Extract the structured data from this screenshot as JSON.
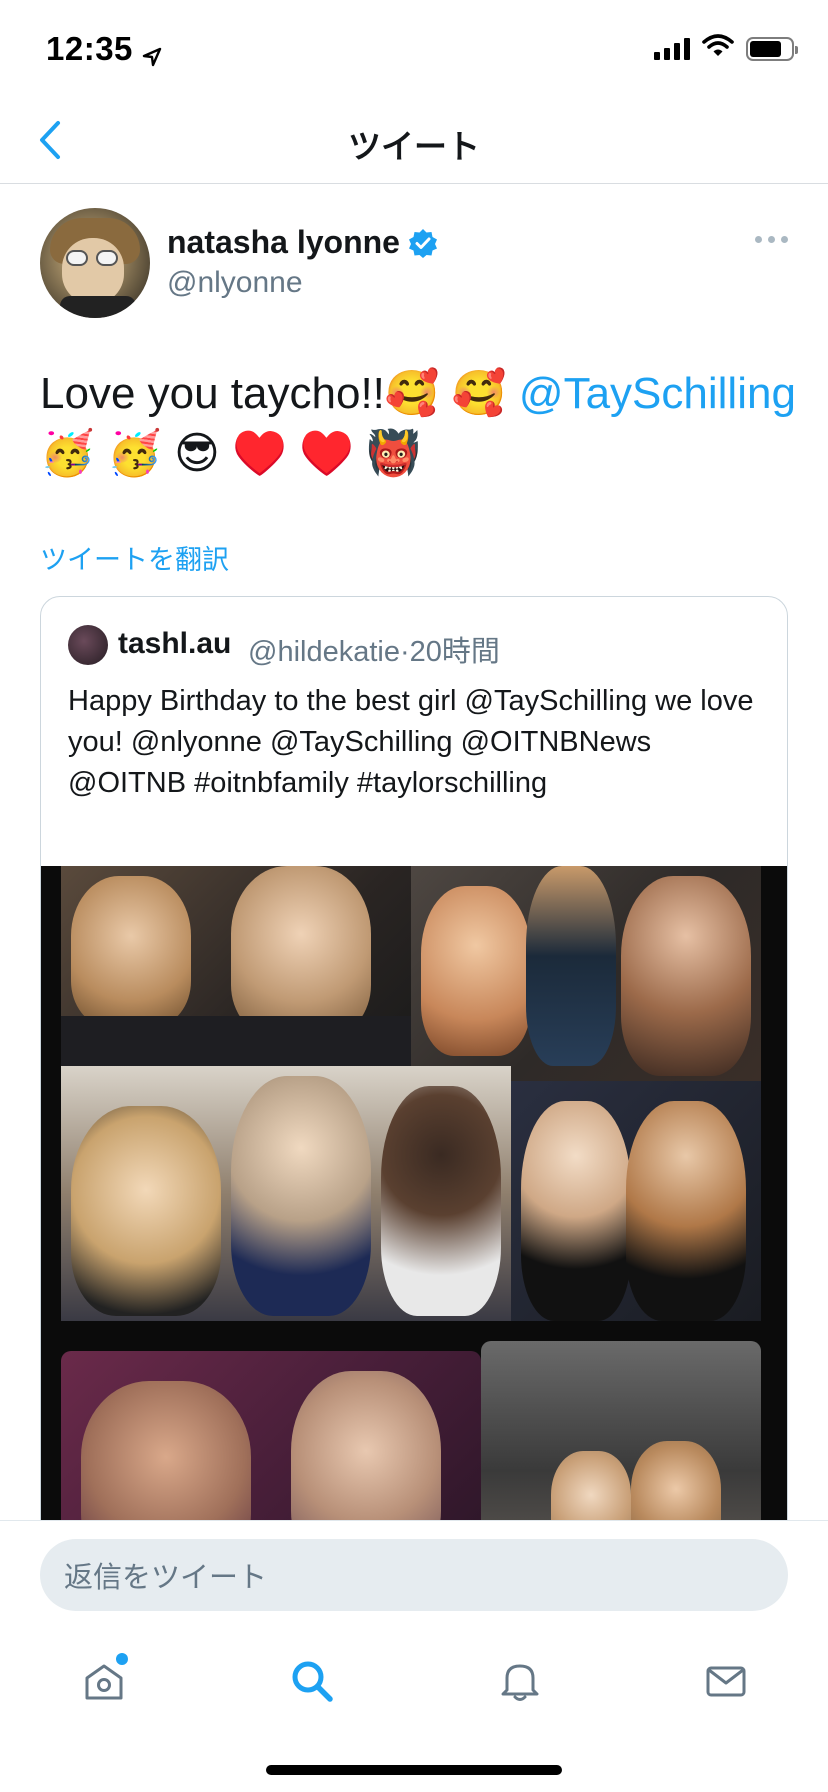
{
  "status_bar": {
    "time": "12:35"
  },
  "nav": {
    "title": "ツイート"
  },
  "tweet": {
    "author_name": "natasha lyonne",
    "author_handle": "@nlyonne",
    "text_prefix": "Love you taycho!!🥰 🥰 ",
    "mention": "@TaySchilling",
    "text_suffix": "🥳 🥳 😎 ♥️ ♥️ 👹",
    "translate_label": "ツイートを翻訳"
  },
  "quoted": {
    "name": "tashl.au",
    "handle": "@hildekatie",
    "time": "20時間",
    "text": "Happy Birthday to the best girl @TaySchilling we love you! @nlyonne @TaySchilling @OITNBNews @OITNB #oitnbfamily #taylorschilling"
  },
  "reply": {
    "placeholder": "返信をツイート"
  },
  "tabs": [
    {
      "icon": "home-icon"
    },
    {
      "icon": "search-icon"
    },
    {
      "icon": "bell-icon"
    },
    {
      "icon": "mail-icon"
    }
  ],
  "colors": {
    "accent": "#1da1f2",
    "secondary_text": "#657786",
    "border": "#ccd6dd"
  }
}
